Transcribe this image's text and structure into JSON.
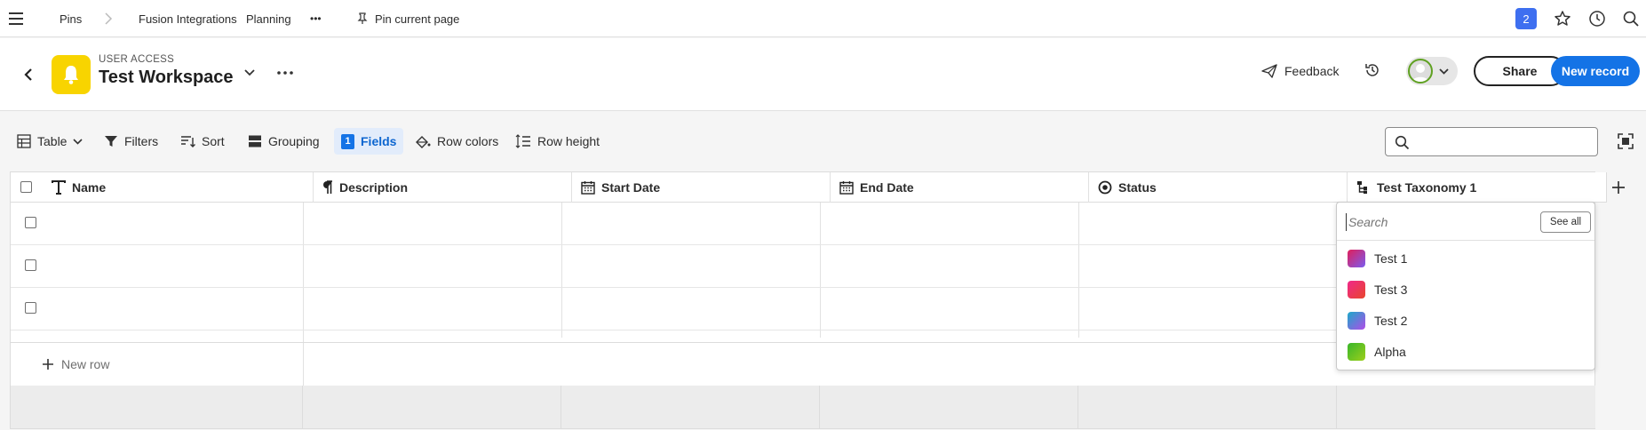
{
  "topnav": {
    "pins": "Pins",
    "crumbs": [
      "Fusion Integrations",
      "Planning"
    ],
    "more": "•••",
    "pin_current": "Pin current page",
    "notification_count": "2"
  },
  "header": {
    "kicker": "USER ACCESS",
    "title": "Test Workspace",
    "feedback": "Feedback",
    "share": "Share",
    "new_record": "New record"
  },
  "toolbar": {
    "table": "Table",
    "filters": "Filters",
    "sort": "Sort",
    "grouping": "Grouping",
    "fields_count": "1",
    "fields": "Fields",
    "row_colors": "Row colors",
    "row_height": "Row height",
    "search_placeholder": ""
  },
  "columns": [
    {
      "label": "Name",
      "icon": "text-type-icon"
    },
    {
      "label": "Description",
      "icon": "paragraph-icon"
    },
    {
      "label": "Start Date",
      "icon": "calendar-icon"
    },
    {
      "label": "End Date",
      "icon": "calendar-icon"
    },
    {
      "label": "Status",
      "icon": "status-icon"
    },
    {
      "label": "Test Taxonomy 1",
      "icon": "taxonomy-icon"
    }
  ],
  "new_row": "New row",
  "dropdown": {
    "search_placeholder": "Search",
    "see_all": "See all",
    "options": [
      {
        "label": "Test 1",
        "colors": [
          "#e01f5a",
          "#7b5cf0"
        ]
      },
      {
        "label": "Test 3",
        "colors": [
          "#f0288a",
          "#e8462d"
        ]
      },
      {
        "label": "Test 2",
        "colors": [
          "#1ba9c9",
          "#b04de8"
        ]
      },
      {
        "label": "Alpha",
        "colors": [
          "#38b62a",
          "#9ccf1c"
        ]
      }
    ]
  }
}
